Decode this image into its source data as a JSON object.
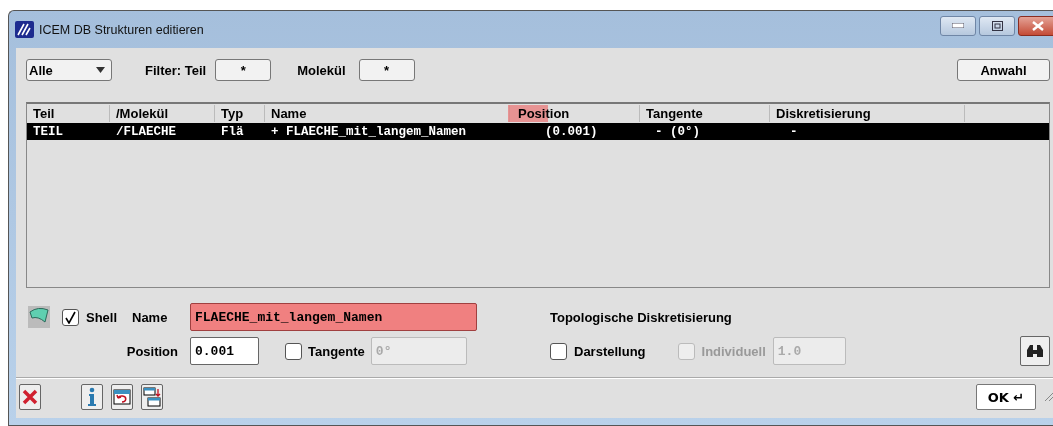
{
  "window": {
    "title": "ICEM DB Strukturen editieren"
  },
  "toolbar": {
    "scope": "Alle",
    "filter_label": "Filter: Teil",
    "teil_filter": "*",
    "molekuel_label": "Molekül",
    "molekuel_filter": "*",
    "select_button": "Anwahl"
  },
  "table": {
    "columns": [
      {
        "label": "Teil",
        "resizing": false
      },
      {
        "label": "/Molekül",
        "resizing": false
      },
      {
        "label": "Typ",
        "resizing": false
      },
      {
        "label": "Name",
        "resizing": false
      },
      {
        "label": "Position",
        "resizing": true
      },
      {
        "label": "Tangente",
        "resizing": false
      },
      {
        "label": "Diskretisierung",
        "resizing": false
      }
    ],
    "rows": [
      {
        "selected": true,
        "cells": [
          "TEIL",
          "/FLAECHE",
          "Flä",
          "+ FLAECHE_mit_langem_Namen",
          "(0.001)",
          "- (0°)",
          "-"
        ]
      }
    ]
  },
  "form": {
    "shell": {
      "label": "Shell",
      "checked": true
    },
    "name_label": "Name",
    "name_field": {
      "value": "FLAECHE_mit_langem_Namen",
      "highlighted": true
    },
    "section_title": "Topologische Diskretisierung",
    "position_label": "Position",
    "position_field": {
      "value": "0.001",
      "disabled": false
    },
    "tangente": {
      "label": "Tangente",
      "checked": false,
      "disabled": false
    },
    "tangente_field": {
      "value": "0°",
      "disabled": true
    },
    "darstellung": {
      "label": "Darstellung",
      "checked": false,
      "disabled": false
    },
    "individuell": {
      "label": "Individuell",
      "checked": false,
      "disabled": true
    },
    "individuell_field": {
      "value": "1.0",
      "disabled": true
    }
  },
  "footer": {
    "ok_button": "OK ↵"
  }
}
